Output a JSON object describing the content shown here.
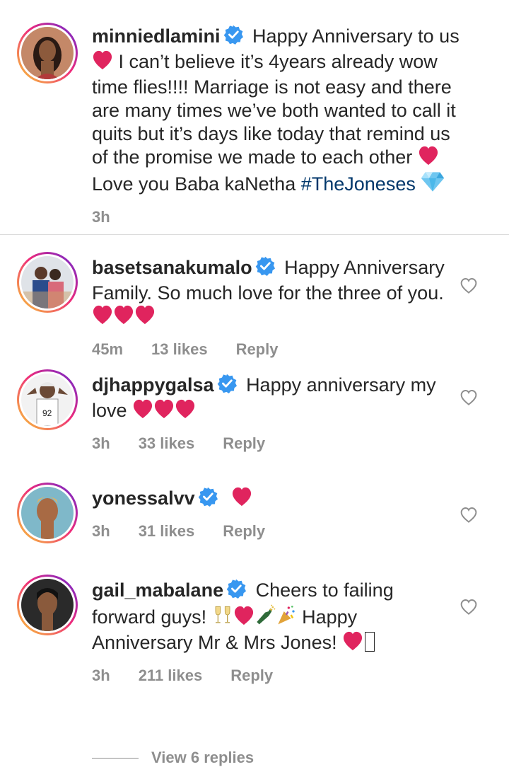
{
  "caption": {
    "username": "minniedlamini",
    "text_part1": "Happy Anniversary to us",
    "text_part2": "I can’t believe it’s 4years already wow time flies!!!! Marriage is not easy and there are many times we’ve both wanted to call it quits but it’s days like today that remind us of the promise we made to each other",
    "text_part3": "Love you Baba kaNetha",
    "hashtag": "#TheJoneses",
    "time": "3h"
  },
  "comments": [
    {
      "username": "basetsanakumalo",
      "text": "Happy Anniversary Family. So much love for the three of you.",
      "time": "45m",
      "likes": "13 likes",
      "reply": "Reply"
    },
    {
      "username": "djhappygalsa",
      "text": "Happy anniversary my love",
      "time": "3h",
      "likes": "33 likes",
      "reply": "Reply"
    },
    {
      "username": "yonessalvv",
      "text": "",
      "time": "3h",
      "likes": "31 likes",
      "reply": "Reply"
    },
    {
      "username": "gail_mabalane",
      "text_part1": "Cheers to failing forward guys!",
      "text_part2": "Happy Anniversary Mr & Mrs Jones!",
      "time": "3h",
      "likes": "211 likes",
      "reply": "Reply"
    }
  ],
  "view_replies": "View 6 replies",
  "colors": {
    "verified": "#3897f0",
    "heart": "#e0245e",
    "hashtag": "#00376b",
    "meta": "#8e8e8e"
  }
}
